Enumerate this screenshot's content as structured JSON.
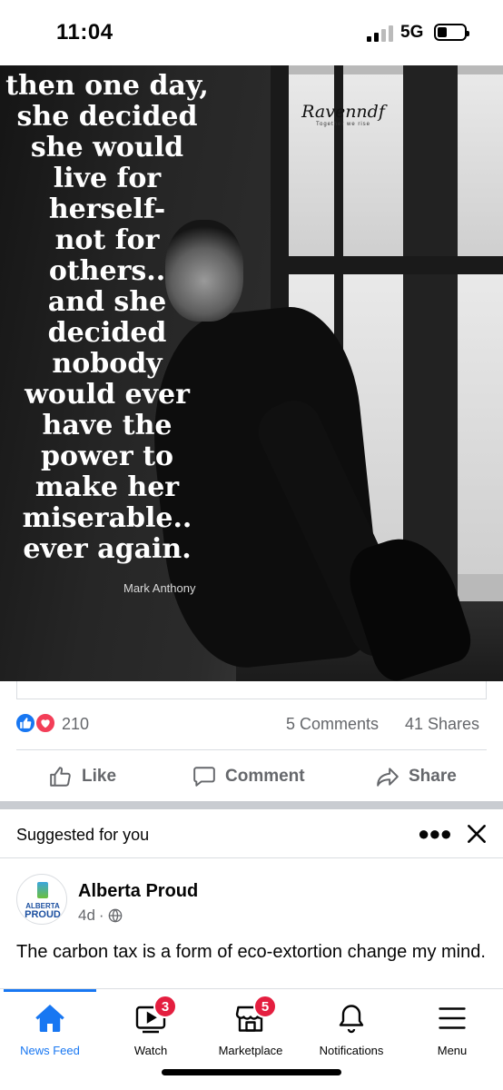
{
  "status_bar": {
    "time": "11:04",
    "network": "5G"
  },
  "post": {
    "quote_lines": [
      "then one day,",
      "she decided",
      "she would",
      "live for",
      "herself-",
      "not for",
      "others..",
      "and she",
      "decided",
      "nobody",
      "would ever",
      "have the",
      "power to",
      "make her",
      "miserable..",
      "ever again."
    ],
    "author": "Mark Anthony",
    "brand_name": "Ravenndf",
    "brand_tagline": "Together we rise",
    "reaction_count": "210",
    "comments": "5 Comments",
    "shares": "41 Shares",
    "actions": {
      "like": "Like",
      "comment": "Comment",
      "share": "Share"
    }
  },
  "suggested": {
    "title": "Suggested for you",
    "page_name": "Alberta Proud",
    "avatar_line1": "ALBERTA",
    "avatar_line2": "PROUD",
    "time": "4d",
    "separator": "·",
    "text": "The carbon tax is a form of eco-extortion change my mind."
  },
  "tabbar": {
    "items": [
      {
        "label": "News Feed",
        "icon": "home-icon",
        "active": true
      },
      {
        "label": "Watch",
        "icon": "video-icon",
        "badge": "3"
      },
      {
        "label": "Marketplace",
        "icon": "store-icon",
        "badge": "5"
      },
      {
        "label": "Notifications",
        "icon": "bell-icon"
      },
      {
        "label": "Menu",
        "icon": "hamburger-icon"
      }
    ]
  },
  "colors": {
    "accent": "#1877f2",
    "love": "#f33e58",
    "badge": "#e41e3f",
    "secondary_text": "#65676b"
  }
}
